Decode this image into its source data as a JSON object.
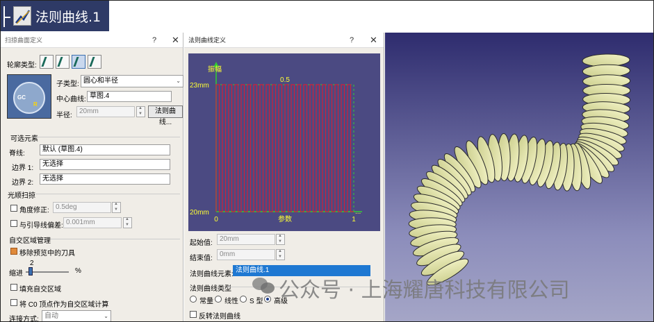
{
  "tree_badge": {
    "label": "法则曲线.1"
  },
  "sweep_dialog": {
    "title": "扫掠曲面定义",
    "help": "?",
    "close": "✕",
    "profile_type_label": "轮廓类型:",
    "profile_type_icons": [
      "explicit-profile-icon",
      "line-profile-icon",
      "circle-profile-icon",
      "conic-profile-icon"
    ],
    "subtype_label": "子类型:",
    "subtype_value": "圆心和半径",
    "center_curve_label": "中心曲线:",
    "center_curve_value": "草图.4",
    "radius_label": "半径:",
    "radius_value": "20mm",
    "law_button": "法则曲线...",
    "preview_gc": "GC",
    "preview_r": "R",
    "optional_section": "可选元素",
    "spine_label": "脊线:",
    "spine_value": "默认 (草图.4)",
    "boundary1_label": "边界 1:",
    "boundary1_value": "无选择",
    "boundary2_label": "边界 2:",
    "boundary2_value": "无选择",
    "smooth_section": "光顺扫掠",
    "angle_label": "角度修正:",
    "angle_value": "0.5deg",
    "deviation_label": "与引导线偏差:",
    "deviation_value": "0.001mm",
    "self_intersect_section": "自交区域管理",
    "remove_cutter_label": "移除预览中的刀具",
    "retract_label": "缩进",
    "retract_value": "2",
    "retract_unit": "%",
    "fill_label": "填充自交区域",
    "c0_label": "将 C0 顶点作为自交区域计算",
    "connection_label": "连接方式:",
    "connection_value": "自动"
  },
  "law_dialog": {
    "title": "法则曲线定义",
    "help": "?",
    "close": "✕",
    "start_label": "起始值:",
    "start_value": "20mm",
    "end_label": "结束值:",
    "end_value": "0mm",
    "element_label": "法则曲线元素:",
    "element_value": "法则曲线.1",
    "type_section": "法则曲线类型",
    "types": [
      "常量",
      "线性",
      "S 型",
      "高级"
    ],
    "selected_type": "高级",
    "invert_label": "反转法则曲线"
  },
  "chart_data": {
    "type": "line",
    "ylabel": "振幅",
    "xlabel": "参数",
    "y_top_label": "23mm",
    "y_bottom_label": "20mm",
    "x_tick_labels": [
      "0",
      "0.5",
      "1"
    ],
    "x_end_label": "...",
    "xlim": [
      0,
      1
    ],
    "ylim": [
      20,
      23
    ],
    "periods": 22,
    "series": [
      {
        "shape": "square-wave",
        "low": 20,
        "high": 23
      }
    ],
    "colors": {
      "background": "#4b4a82",
      "axis": "#33cc33",
      "curve": "#d0203a",
      "grid": "#33cc33",
      "labels": "#ffff33"
    }
  },
  "watermark": {
    "text": "公众号 · 上海耀唐科技有限公司"
  },
  "view3d": {
    "object": "coil-tube"
  }
}
